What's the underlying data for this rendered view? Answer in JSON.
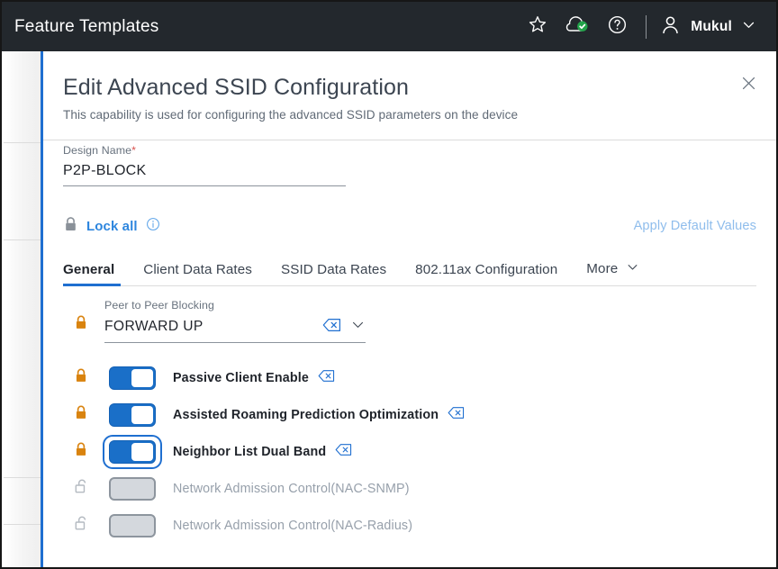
{
  "appbar": {
    "title": "Feature Templates",
    "icons": {
      "favorite": "star-icon",
      "cloud_status": "cloud-check-icon",
      "help": "help-circle-icon",
      "avatar": "user-avatar-icon",
      "chevron": "chevron-down-icon"
    },
    "user_name": "Mukul"
  },
  "panel": {
    "title": "Edit Advanced SSID Configuration",
    "subtitle": "This capability is used for configuring the advanced SSID parameters on the device",
    "close_label": "close-icon"
  },
  "design_name": {
    "label": "Design Name",
    "required_mark": "*",
    "value": "P2P-BLOCK",
    "placeholder": "Design Name"
  },
  "lock_all": {
    "label": "Lock all",
    "lock_icon": "lock-closed-icon",
    "info_icon": "info-circle-icon"
  },
  "apply_default": {
    "label": "Apply Default Values"
  },
  "tabs": [
    {
      "label": "General",
      "active": true
    },
    {
      "label": "Client Data Rates",
      "active": false
    },
    {
      "label": "SSID Data Rates",
      "active": false
    },
    {
      "label": "802.11ax Configuration",
      "active": false
    },
    {
      "label": "More",
      "active": false,
      "chevron": "chevron-down-icon"
    }
  ],
  "peer_to_peer": {
    "label": "Peer to Peer Blocking",
    "value": "FORWARD UP",
    "lock_state": "locked",
    "clear_icon": "clear-value-icon",
    "chevron_icon": "chevron-down-icon"
  },
  "toggles": [
    {
      "label": "Passive Client Enable",
      "state": "on",
      "lock_state": "locked",
      "has_clear": true,
      "focused": false,
      "disabled": false
    },
    {
      "label": "Assisted Roaming Prediction Optimization",
      "state": "on",
      "lock_state": "locked",
      "has_clear": true,
      "focused": false,
      "disabled": false
    },
    {
      "label": "Neighbor List Dual Band",
      "state": "on",
      "lock_state": "locked",
      "has_clear": true,
      "focused": true,
      "disabled": false
    },
    {
      "label": "Network Admission Control(NAC-SNMP)",
      "state": "off",
      "lock_state": "unlocked",
      "has_clear": false,
      "focused": false,
      "disabled": true
    },
    {
      "label": "Network Admission Control(NAC-Radius)",
      "state": "off",
      "lock_state": "unlocked",
      "has_clear": false,
      "focused": false,
      "disabled": true
    }
  ],
  "colors": {
    "appbar_bg": "#23282d",
    "accent_blue": "#1f6fd0",
    "link_blue": "#2e86de",
    "lock_orange": "#d9830f",
    "toggle_on": "#1a6fc8",
    "toggle_off": "#d4d8dd",
    "cloud_green": "#22a34a",
    "required_red": "#d9534f"
  }
}
